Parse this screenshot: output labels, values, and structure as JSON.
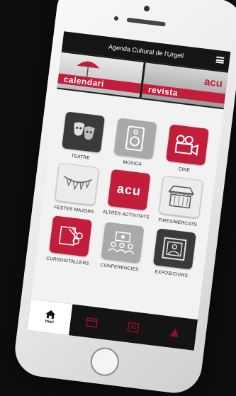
{
  "app": {
    "title": "Agenda Cultural de l'Urgell"
  },
  "banners": [
    {
      "text": "calendari"
    },
    {
      "logo": "acu",
      "text": "revista"
    }
  ],
  "tiles": [
    {
      "label": "TEATRE",
      "icon": "masks-icon",
      "color": "#3a3a3a"
    },
    {
      "label": "MÚSICA",
      "icon": "speaker-icon",
      "color": "#a9a9a9"
    },
    {
      "label": "CINE",
      "icon": "film-camera-icon",
      "color": "#c21d3a"
    },
    {
      "label": "FESTES MAJORS",
      "icon": "garland-icon",
      "color": "#ececec"
    },
    {
      "label": "ALTRES ACTIVITATS",
      "logo": "acu",
      "icon": "acu-logo-icon",
      "color": "#c21d3a"
    },
    {
      "label": "FIRES/MERCATS",
      "icon": "market-stall-icon",
      "color": "#ececec"
    },
    {
      "label": "CURSOS/TALLERS",
      "icon": "scissors-icon",
      "color": "#c21d3a"
    },
    {
      "label": "CONFERÈNCIES",
      "icon": "conference-icon",
      "color": "#a9a9a9"
    },
    {
      "label": "EXPOSICIONS",
      "icon": "picture-frame-icon",
      "color": "#3a3a3a"
    }
  ],
  "tabbar": [
    {
      "label": "Inici",
      "icon": "home-icon",
      "active": true
    },
    {
      "label": "",
      "icon": "calendar-icon",
      "active": false
    },
    {
      "label": "",
      "icon": "news-icon",
      "active": false
    },
    {
      "label": "",
      "icon": "alert-icon",
      "active": false
    }
  ],
  "colors": {
    "accent": "#c21d3a",
    "titlebar": "#151515"
  }
}
